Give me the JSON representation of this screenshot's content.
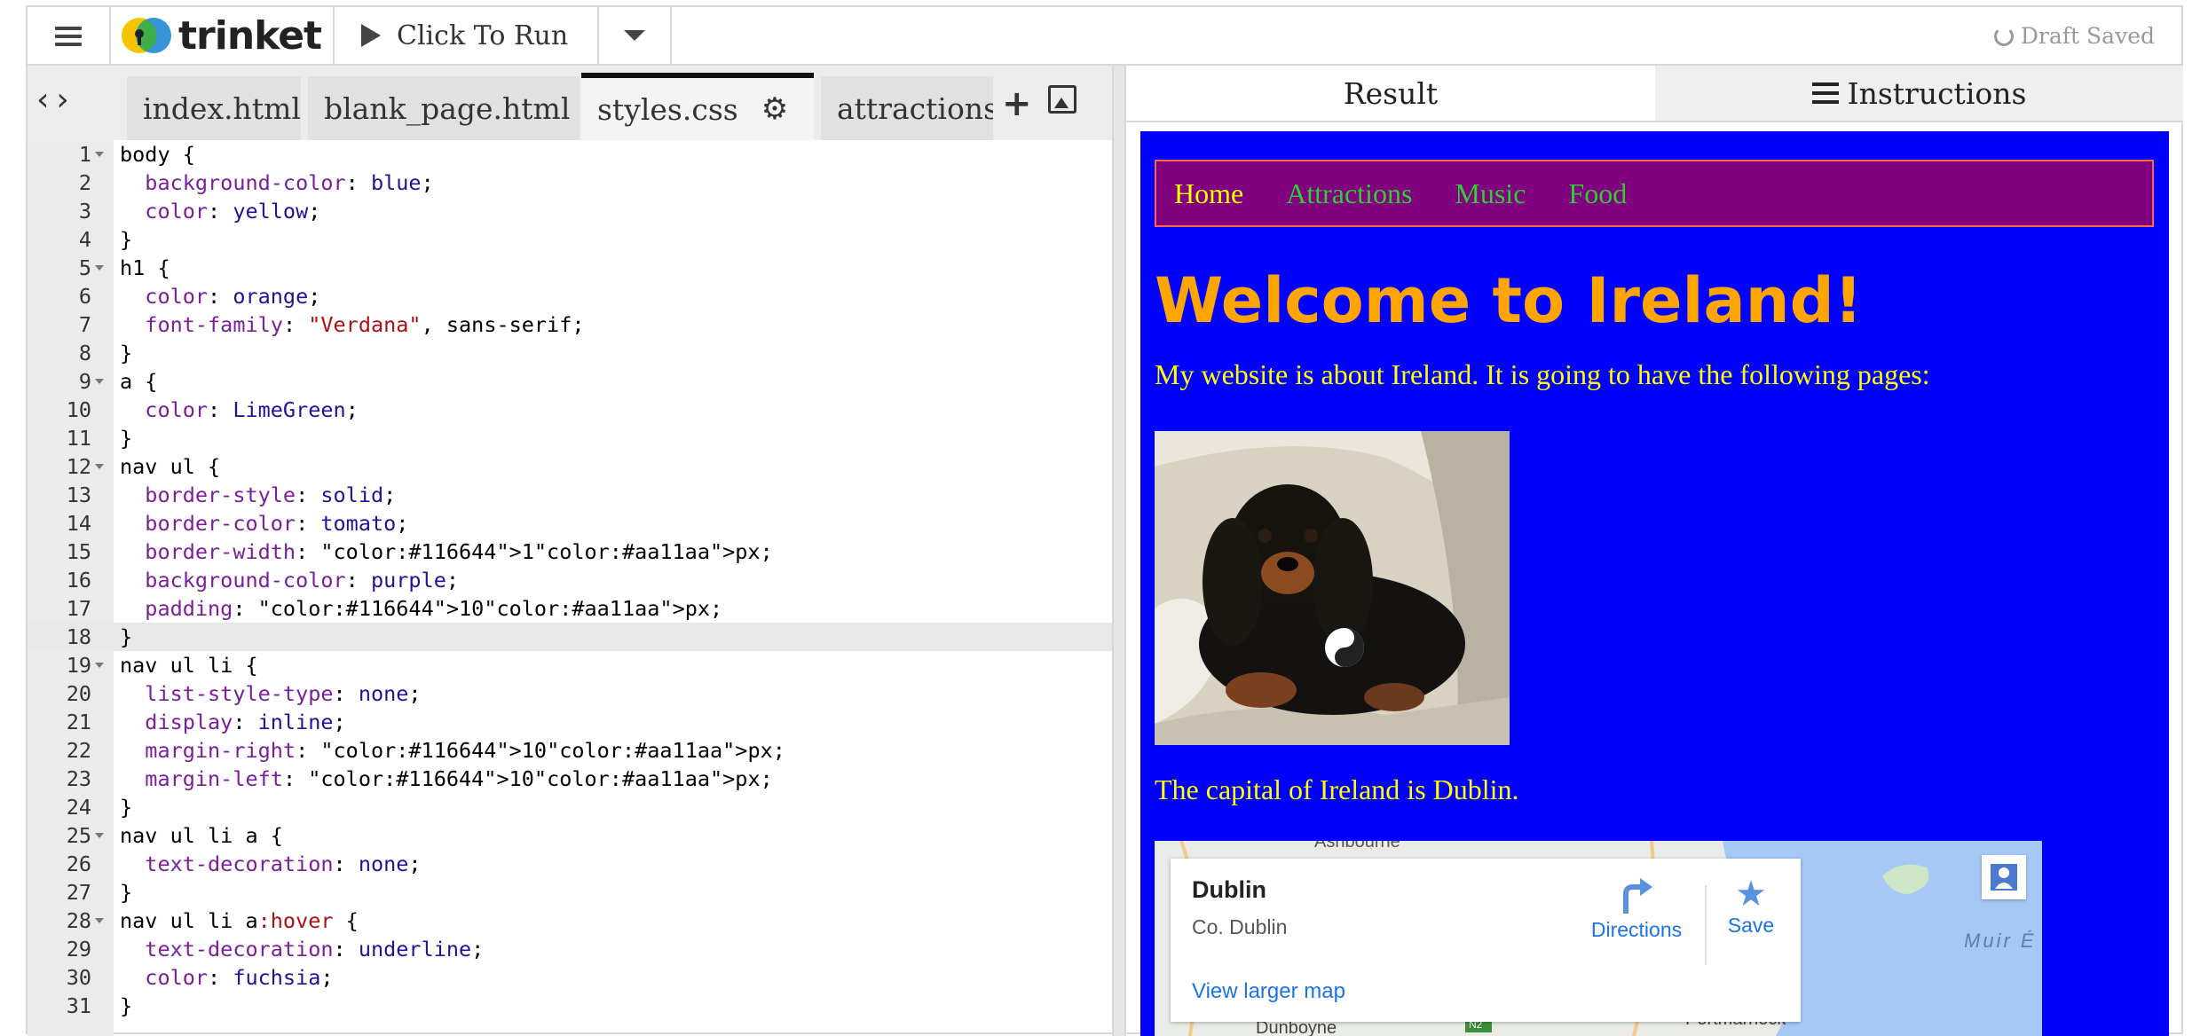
{
  "topbar": {
    "logo_text": "trinket",
    "run_label": "Click To Run",
    "status": "Draft Saved"
  },
  "editor": {
    "tabs": [
      {
        "label": "index.html",
        "active": false
      },
      {
        "label": "blank_page.html",
        "active": false
      },
      {
        "label": "styles.css",
        "active": true
      },
      {
        "label": "attractions.",
        "active": false
      }
    ],
    "current_line": 18,
    "lines": [
      {
        "n": "1",
        "text": "body {",
        "fold": true
      },
      {
        "n": "2",
        "text": "  background-color: blue;"
      },
      {
        "n": "3",
        "text": "  color: yellow;"
      },
      {
        "n": "4",
        "text": "}"
      },
      {
        "n": "5",
        "text": "h1 {",
        "fold": true
      },
      {
        "n": "6",
        "text": "  color: orange;"
      },
      {
        "n": "7",
        "text": "  font-family: \"Verdana\", sans-serif;"
      },
      {
        "n": "8",
        "text": "}"
      },
      {
        "n": "9",
        "text": "a {",
        "fold": true
      },
      {
        "n": "10",
        "text": "  color: LimeGreen;"
      },
      {
        "n": "11",
        "text": "}"
      },
      {
        "n": "12",
        "text": "nav ul {",
        "fold": true
      },
      {
        "n": "13",
        "text": "  border-style: solid;"
      },
      {
        "n": "14",
        "text": "  border-color: tomato;"
      },
      {
        "n": "15",
        "text": "  border-width: 1px;"
      },
      {
        "n": "16",
        "text": "  background-color: purple;"
      },
      {
        "n": "17",
        "text": "  padding: 10px;"
      },
      {
        "n": "18",
        "text": "}"
      },
      {
        "n": "19",
        "text": "nav ul li {",
        "fold": true
      },
      {
        "n": "20",
        "text": "  list-style-type: none;"
      },
      {
        "n": "21",
        "text": "  display: inline;"
      },
      {
        "n": "22",
        "text": "  margin-right: 10px;"
      },
      {
        "n": "23",
        "text": "  margin-left: 10px;"
      },
      {
        "n": "24",
        "text": "}"
      },
      {
        "n": "25",
        "text": "nav ul li a {",
        "fold": true
      },
      {
        "n": "26",
        "text": "  text-decoration: none;"
      },
      {
        "n": "27",
        "text": "}"
      },
      {
        "n": "28",
        "text": "nav ul li a:hover {",
        "fold": true
      },
      {
        "n": "29",
        "text": "  text-decoration: underline;"
      },
      {
        "n": "30",
        "text": "  color: fuchsia;"
      },
      {
        "n": "31",
        "text": "}"
      }
    ]
  },
  "result_pane": {
    "tabs": {
      "result": "Result",
      "instructions": "Instructions"
    },
    "nav_links": [
      "Home",
      "Attractions",
      "Music",
      "Food"
    ],
    "heading": "Welcome to Ireland!",
    "intro": "My website is about Ireland. It is going to have the following pages:",
    "capital": "The capital of Ireland is Dublin.",
    "map": {
      "place": "Dublin",
      "region": "Co. Dublin",
      "directions": "Directions",
      "save": "Save",
      "larger_map": "View larger map",
      "label_top": "Ashbourne",
      "label_right": "Muir É",
      "label_bottom_left": "Dunboyne",
      "label_bottom_right": "Portmarnock",
      "road": "N2"
    }
  },
  "colors": {
    "preview_bg": "#0000ff",
    "nav_bg": "#800080",
    "nav_border": "#ff6347",
    "link": "#32cd32",
    "heading": "#ffa500",
    "text": "#ffff00",
    "tab_active_border": "#111111"
  }
}
